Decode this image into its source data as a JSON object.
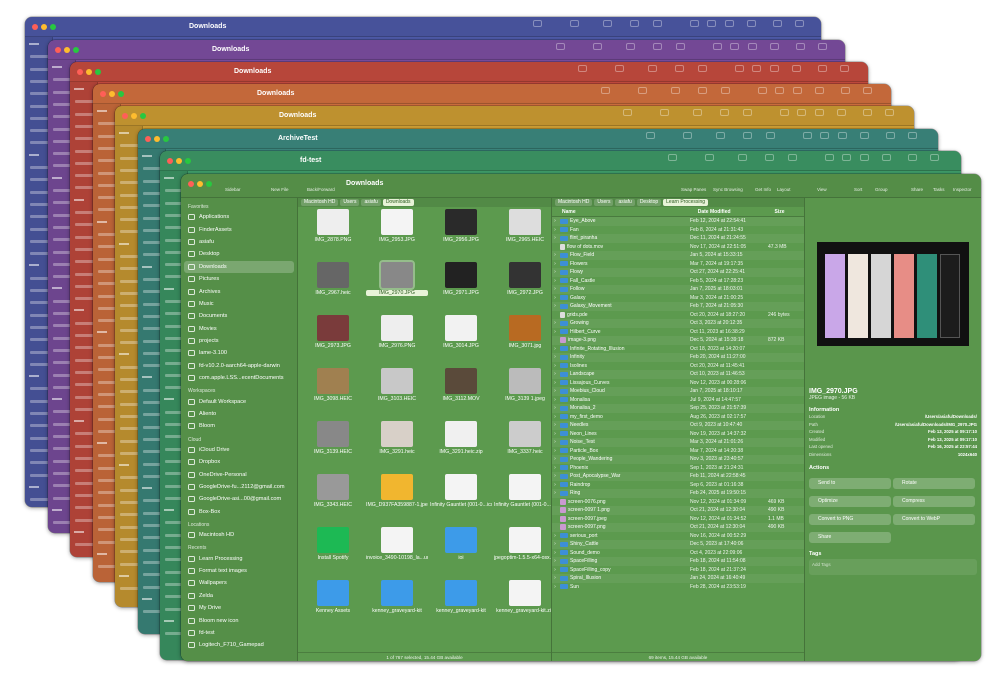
{
  "windows": [
    {
      "title": "Downloads",
      "color": "#4e5aa8"
    },
    {
      "title": "Downloads",
      "color": "#7d4fa2"
    },
    {
      "title": "Downloads",
      "color": "#c74c3f"
    },
    {
      "title": "Downloads",
      "color": "#d4713f"
    },
    {
      "title": "Downloads",
      "color": "#cf9e34"
    },
    {
      "title": "ArchiveTest",
      "color": "#3d8a80"
    },
    {
      "title": "fd-test",
      "color": "#3e9a68"
    }
  ],
  "toolbar": {
    "sidebar": "Sidebar",
    "new_file": "New File",
    "back_forward": "Back/Forward",
    "swap_panes": "Swap Panes",
    "sync_browsing": "Sync Browsing",
    "get_info": "Get Info",
    "layout": "Layout",
    "view": "View",
    "sort": "Sort",
    "group": "Group",
    "share": "Share",
    "tasks": "Tasks",
    "inspector": "Inspector",
    "title": "Downloads"
  },
  "sidebar": {
    "favorites_label": "Favorites",
    "favorites": [
      "Applications",
      "FinderAssets",
      "asiafu",
      "Desktop",
      "Downloads",
      "Pictures",
      "Archives",
      "Music",
      "Documents",
      "Movies",
      "projects",
      "lame-3.100",
      "fd-v10.2.0-aarch64-apple-darwin",
      "com.apple.LSS...ecentDocuments"
    ],
    "workspaces_label": "Workspaces",
    "workspaces": [
      "Default Workspace",
      "Aliento",
      "Bloom"
    ],
    "cloud_label": "Cloud",
    "cloud": [
      "iCloud Drive",
      "Dropbox",
      "OneDrive-Personal",
      "GoogleDrive-fu...2112@gmail.com",
      "GoogleDrive-asi...00@gmail.com",
      "Box-Box"
    ],
    "locations_label": "Locations",
    "locations": [
      "Macintosh HD"
    ],
    "recents_label": "Recents",
    "recents": [
      "Learn Processing",
      "Format text images",
      "Wallpapers",
      "Zelda",
      "My Drive",
      "Bloom new icon",
      "fd-test",
      "Logitech_F710_Gamepad"
    ]
  },
  "left_pane": {
    "crumbs": [
      "Macintosh HD",
      "Users",
      "asiafu",
      "Downloads"
    ],
    "items": [
      {
        "label": "IMG_2878.PNG",
        "color": "#eee"
      },
      {
        "label": "IMG_2953.JPG",
        "color": "#f4f4f4"
      },
      {
        "label": "IMG_2956.JPG",
        "color": "#2a2a2a"
      },
      {
        "label": "IMG_2965.HEIC",
        "color": "#ddd"
      },
      {
        "label": "IMG_2967.heic",
        "color": "#666"
      },
      {
        "label": "IMG_2970.JPG",
        "color": "#888"
      },
      {
        "label": "IMG_2971.JPG",
        "color": "#222"
      },
      {
        "label": "IMG_2972.JPG",
        "color": "#333"
      },
      {
        "label": "IMG_2973.JPG",
        "color": "#7a3b3b"
      },
      {
        "label": "IMG_2976.PNG",
        "color": "#eee"
      },
      {
        "label": "IMG_3014.JPG",
        "color": "#f2f2f2"
      },
      {
        "label": "IMG_3071.jpg",
        "color": "#b86a22"
      },
      {
        "label": "IMG_3098.HEIC",
        "color": "#a08050"
      },
      {
        "label": "IMG_3103.HEIC",
        "color": "#c8c8c8"
      },
      {
        "label": "IMG_3112.MOV",
        "color": "#5a4a3a"
      },
      {
        "label": "IMG_3139 1.jpeg",
        "color": "#bbb"
      },
      {
        "label": "IMG_3139.HEIC",
        "color": "#888"
      },
      {
        "label": "IMG_3291.heic",
        "color": "#d8d0c8"
      },
      {
        "label": "IMG_3291.heic.zip",
        "color": "#f0f0f0"
      },
      {
        "label": "IMG_3337.heic",
        "color": "#ccc"
      },
      {
        "label": "IMG_3343.HEIC",
        "color": "#999"
      },
      {
        "label": "IMG_D937FA359887-1.jpeg",
        "color": "#f1b62f"
      },
      {
        "label": "Infinity Gauntlet (001-0...ics.INFO",
        "color": "#f4f4f4"
      },
      {
        "label": "Infinity Gauntlet (001-0...INFO.zip",
        "color": "#f4f4f4"
      },
      {
        "label": "Install Spotify",
        "color": "#1db954"
      },
      {
        "label": "invoice_3490-10198_la...udio.pdf",
        "color": "#f4f4f4"
      },
      {
        "label": "ioi",
        "color": "#3d9be9"
      },
      {
        "label": "jpegoptim-1.5.5-x64-osx.zip",
        "color": "#f4f4f4"
      },
      {
        "label": "Kenney Assets",
        "color": "#3d9be9"
      },
      {
        "label": "kenney_graveyard-kit",
        "color": "#3d9be9"
      },
      {
        "label": "kenney_graveyard-kit",
        "color": "#3d9be9"
      },
      {
        "label": "kenney_graveyard-kit.zip",
        "color": "#f4f4f4"
      }
    ],
    "status": "1 of 767 selected, 15.44 GB available"
  },
  "right_pane": {
    "crumbs": [
      "Macintosh HD",
      "Users",
      "asiafu",
      "Desktop",
      "Learn Processing"
    ],
    "columns": {
      "name": "Name",
      "date": "Date Modified",
      "size": "Size"
    },
    "rows": [
      {
        "n": "Eye_Above",
        "d": "Feb 12, 2024 at 22:54:41",
        "s": "",
        "t": "folder"
      },
      {
        "n": "Fan",
        "d": "Feb 8, 2024 at 21:31:43",
        "s": "",
        "t": "folder"
      },
      {
        "n": "flint_piranha",
        "d": "Dec 11, 2024 at 21:24:55",
        "s": "",
        "t": "folder"
      },
      {
        "n": "flow of dots.mov",
        "d": "Nov 17, 2024 at 22:51:05",
        "s": "47.3 MB",
        "t": "file"
      },
      {
        "n": "Flow_Field",
        "d": "Jan 5, 2024 at 15:33:15",
        "s": "",
        "t": "folder"
      },
      {
        "n": "Flowers",
        "d": "Mar 7, 2024 at 19:17:35",
        "s": "",
        "t": "folder"
      },
      {
        "n": "Flowy",
        "d": "Oct 27, 2024 at 22:25:41",
        "s": "",
        "t": "folder"
      },
      {
        "n": "Fall_Castle",
        "d": "Feb 5, 2024 at 17:28:23",
        "s": "",
        "t": "folder"
      },
      {
        "n": "Follow",
        "d": "Jan 7, 2025 at 18:03:01",
        "s": "",
        "t": "folder"
      },
      {
        "n": "Galaxy",
        "d": "Mar 3, 2024 at 21:00:25",
        "s": "",
        "t": "folder"
      },
      {
        "n": "Galaxy_Movement",
        "d": "Feb 7, 2024 at 21:05:30",
        "s": "",
        "t": "folder"
      },
      {
        "n": "grids.pde",
        "d": "Oct 20, 2024 at 18:27:20",
        "s": "246 bytes",
        "t": "file"
      },
      {
        "n": "Growing",
        "d": "Oct 3, 2023 at 20:12:35",
        "s": "",
        "t": "folder"
      },
      {
        "n": "Hilbert_Curve",
        "d": "Oct 11, 2023 at 16:38:29",
        "s": "",
        "t": "folder"
      },
      {
        "n": "image-3.png",
        "d": "Dec 5, 2024 at 15:39:18",
        "s": "872 KB",
        "t": "img"
      },
      {
        "n": "Infinite_Rotating_Illusion",
        "d": "Oct 18, 2023 at 14:20:07",
        "s": "",
        "t": "folder"
      },
      {
        "n": "Infinity",
        "d": "Feb 20, 2024 at 11:27:00",
        "s": "",
        "t": "folder"
      },
      {
        "n": "Isolines",
        "d": "Oct 20, 2024 at 11:45:41",
        "s": "",
        "t": "folder"
      },
      {
        "n": "Landscape",
        "d": "Oct 10, 2023 at 11:46:53",
        "s": "",
        "t": "folder"
      },
      {
        "n": "Lissajous_Curves",
        "d": "Nov 12, 2023 at 00:28:06",
        "s": "",
        "t": "folder"
      },
      {
        "n": "Moebius_Cloud",
        "d": "Jan 7, 2025 at 18:10:17",
        "s": "",
        "t": "folder"
      },
      {
        "n": "Monalisa",
        "d": "Jul 9, 2024 at 14:47:57",
        "s": "",
        "t": "folder"
      },
      {
        "n": "Monalisa_2",
        "d": "Sep 25, 2023 at 21:57:39",
        "s": "",
        "t": "folder"
      },
      {
        "n": "my_first_demo",
        "d": "Aug 26, 2023 at 02:17:57",
        "s": "",
        "t": "folder"
      },
      {
        "n": "Needles",
        "d": "Oct 9, 2023 at 10:47:40",
        "s": "",
        "t": "folder"
      },
      {
        "n": "Neon_Lines",
        "d": "Nov 19, 2023 at 14:37:32",
        "s": "",
        "t": "folder"
      },
      {
        "n": "Noise_Test",
        "d": "Mar 3, 2024 at 21:01:26",
        "s": "",
        "t": "folder"
      },
      {
        "n": "Particle_Box",
        "d": "Mar 7, 2024 at 14:20:38",
        "s": "",
        "t": "folder"
      },
      {
        "n": "People_Wandering",
        "d": "Nov 3, 2023 at 23:40:57",
        "s": "",
        "t": "folder"
      },
      {
        "n": "Phoenix",
        "d": "Sep 1, 2023 at 21:24:31",
        "s": "",
        "t": "folder"
      },
      {
        "n": "Post_Apocalypse_War",
        "d": "Feb 11, 2024 at 22:58:45",
        "s": "",
        "t": "folder"
      },
      {
        "n": "Raindrop",
        "d": "Sep 6, 2023 at 01:16:38",
        "s": "",
        "t": "folder"
      },
      {
        "n": "Ring",
        "d": "Feb 24, 2025 at 19:50:15",
        "s": "",
        "t": "folder"
      },
      {
        "n": "screen-0076.png",
        "d": "Nov 12, 2024 at 01:34:09",
        "s": "469 KB",
        "t": "img"
      },
      {
        "n": "screen-0097 1.png",
        "d": "Oct 21, 2024 at 12:30:04",
        "s": "490 KB",
        "t": "img"
      },
      {
        "n": "screen-0097.jpeg",
        "d": "Nov 12, 2024 at 01:34:52",
        "s": "1.1 MB",
        "t": "img"
      },
      {
        "n": "screen-0097.png",
        "d": "Oct 21, 2024 at 12:30:04",
        "s": "490 KB",
        "t": "img"
      },
      {
        "n": "serious_port",
        "d": "Nov 16, 2024 at 00:52:29",
        "s": "",
        "t": "folder"
      },
      {
        "n": "Shiny_Cattle",
        "d": "Dec 5, 2023 at 17:40:06",
        "s": "",
        "t": "folder"
      },
      {
        "n": "Sound_demo",
        "d": "Oct 4, 2023 at 22:09:06",
        "s": "",
        "t": "folder"
      },
      {
        "n": "SpaceFilling",
        "d": "Feb 18, 2024 at 11:54:08",
        "s": "",
        "t": "folder"
      },
      {
        "n": "SpaceFilling_copy",
        "d": "Feb 18, 2024 at 21:37:24",
        "s": "",
        "t": "folder"
      },
      {
        "n": "Spiral_Illusion",
        "d": "Jan 24, 2024 at 16:40:49",
        "s": "",
        "t": "folder"
      },
      {
        "n": "Sun",
        "d": "Feb 28, 2024 at 23:53:19",
        "s": "",
        "t": "folder"
      }
    ],
    "status": "69 items, 15.44 GB available"
  },
  "inspector": {
    "file_name": "IMG_2970.JPG",
    "file_type": "JPEG image - 56 KB",
    "info_label": "Information",
    "info": [
      {
        "k": "Location",
        "v": "/Users/asiafu/Downloads/"
      },
      {
        "k": "Path",
        "v": "/Users/asiafu/Downloads/IMG_2970.JPG"
      },
      {
        "k": "Created",
        "v": "Feb 13, 2025 at 09:17:10"
      },
      {
        "k": "Modified",
        "v": "Feb 13, 2025 at 09:17:10"
      },
      {
        "k": "Last opened",
        "v": "Feb 16, 2025 at 22:57:44"
      },
      {
        "k": "Dimensions",
        "v": "1024x640"
      }
    ],
    "actions_label": "Actions",
    "actions": [
      "Send to",
      "Rotate",
      "Optimize",
      "Compress",
      "Convert to PNG",
      "Convert to WebP",
      "Share"
    ],
    "tags_label": "Tags",
    "tags_placeholder": "Add Tags"
  }
}
